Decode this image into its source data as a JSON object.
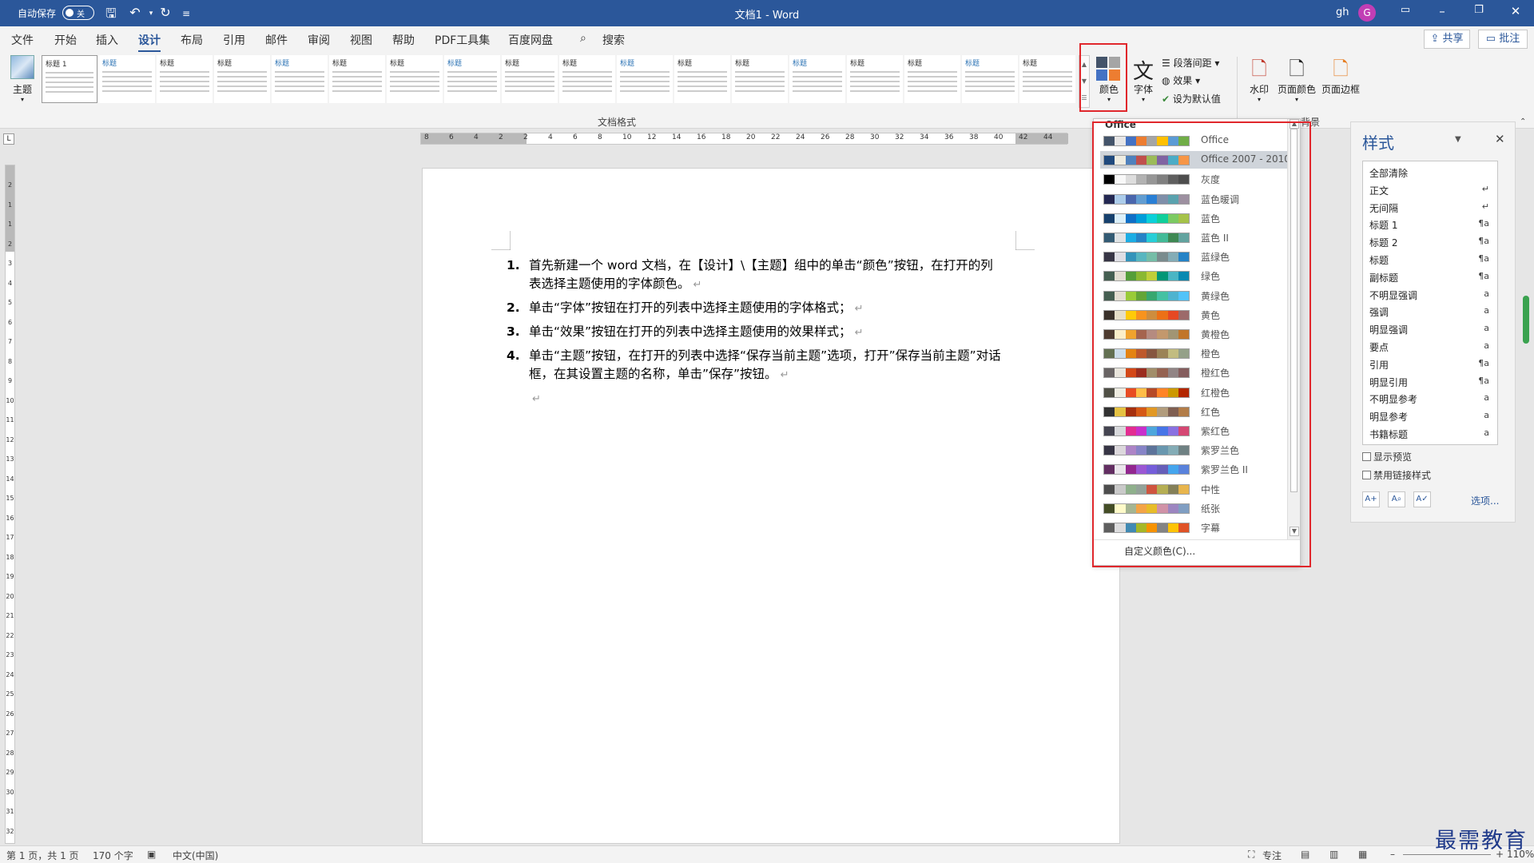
{
  "titlebar": {
    "autosave": "自动保存",
    "autosave_state": "关",
    "title": "文档1  -  Word",
    "user": "gh",
    "avatar_letter": "G"
  },
  "tabs": [
    "文件",
    "开始",
    "插入",
    "设计",
    "布局",
    "引用",
    "邮件",
    "审阅",
    "视图",
    "帮助",
    "PDF工具集",
    "百度网盘"
  ],
  "search_label": "搜索",
  "share_label": "共享",
  "comment_label": "批注",
  "ribbon": {
    "theme_label": "主题",
    "gallery_headings": [
      "标题 1",
      "标题",
      "标题",
      "标题",
      "标题",
      "标题",
      "标题",
      "标题",
      "标题",
      "标题",
      "标题",
      "标题",
      "标题",
      "标题",
      "标题",
      "标题",
      "标题",
      "标题"
    ],
    "group_label_format": "文档格式",
    "colors_label": "颜色",
    "fonts_label": "字体",
    "para_spacing_label": "段落间距",
    "effects_label": "效果",
    "set_default_label": "设为默认值",
    "watermark_label": "水印",
    "page_color_label": "页面颜色",
    "page_border_label": "页面边框",
    "group_label_background": "背景"
  },
  "ruler_numbers": [
    "8",
    "6",
    "4",
    "2",
    "2",
    "4",
    "6",
    "8",
    "10",
    "12",
    "14",
    "16",
    "18",
    "20",
    "22",
    "24",
    "26",
    "28",
    "30",
    "32",
    "34",
    "36",
    "38",
    "40",
    "42",
    "44"
  ],
  "vruler_numbers": [
    "2",
    "1",
    "1",
    "2",
    "3",
    "4",
    "5",
    "6",
    "7",
    "8",
    "9",
    "10",
    "11",
    "12",
    "13",
    "14",
    "15",
    "16",
    "17",
    "18",
    "19",
    "20",
    "21",
    "22",
    "23",
    "24",
    "25",
    "26",
    "27",
    "28",
    "29",
    "30",
    "31",
    "32"
  ],
  "document": {
    "items": [
      {
        "n": "1.",
        "text": "首先新建一个 word 文档，在【设计】\\【主题】组中的单击“颜色”按钮，在打开的列表选择主题使用的字体颜色。"
      },
      {
        "n": "2.",
        "text": "单击“字体”按钮在打开的列表中选择主题使用的字体格式；"
      },
      {
        "n": "3.",
        "text": "单击“效果”按钮在打开的列表中选择主题使用的效果样式；"
      },
      {
        "n": "4.",
        "text": "单击“主题”按钮，在打开的列表中选择“保存当前主题”选项，打开”保存当前主题”对话框，在其设置主题的名称，单击”保存”按钮。"
      }
    ],
    "para_mark": "↵"
  },
  "colors_dropdown": {
    "header": "Office",
    "selected_index": 1,
    "custom_label": "自定义颜色(C)...",
    "schemes": [
      {
        "name": "Office",
        "colors": [
          "#44546a",
          "#e7e6e6",
          "#4472c4",
          "#ed7d31",
          "#a5a5a5",
          "#ffc000",
          "#5b9bd5",
          "#70ad47"
        ]
      },
      {
        "name": "Office 2007 - 2010",
        "colors": [
          "#1f497d",
          "#eeece1",
          "#4f81bd",
          "#c0504d",
          "#9bbb59",
          "#8064a2",
          "#4bacc6",
          "#f79646"
        ]
      },
      {
        "name": "灰度",
        "colors": [
          "#000000",
          "#f8f8f8",
          "#dddddd",
          "#b2b2b2",
          "#969696",
          "#808080",
          "#5f5f5f",
          "#4d4d4d"
        ]
      },
      {
        "name": "蓝色暖调",
        "colors": [
          "#242852",
          "#acccea",
          "#4a66ac",
          "#629dd1",
          "#297fd5",
          "#7f8fa9",
          "#5aa2ae",
          "#9d90a0"
        ]
      },
      {
        "name": "蓝色",
        "colors": [
          "#17406d",
          "#dbeff9",
          "#0f6fc6",
          "#009dd9",
          "#0bd0d9",
          "#10cf9b",
          "#7cca62",
          "#a5c249"
        ]
      },
      {
        "name": "蓝色 II",
        "colors": [
          "#335b74",
          "#dfe3e5",
          "#1cade4",
          "#2683c6",
          "#27ced7",
          "#42ba97",
          "#3e8853",
          "#62a39f"
        ]
      },
      {
        "name": "蓝绿色",
        "colors": [
          "#373545",
          "#dedee4",
          "#3494ba",
          "#58b6c0",
          "#75bda7",
          "#7a8c8e",
          "#84acb6",
          "#2683c6"
        ]
      },
      {
        "name": "绿色",
        "colors": [
          "#455f51",
          "#e3ded1",
          "#549e39",
          "#8ab833",
          "#c0cf3a",
          "#029676",
          "#4ab5c4",
          "#0989b1"
        ]
      },
      {
        "name": "黄绿色",
        "colors": [
          "#455f51",
          "#e3ded1",
          "#99cb38",
          "#63a537",
          "#37a76f",
          "#44c1a3",
          "#4eb3cf",
          "#51c3f9"
        ]
      },
      {
        "name": "黄色",
        "colors": [
          "#39302a",
          "#e5dec9",
          "#ffca08",
          "#f8931d",
          "#ce8d3e",
          "#ec7016",
          "#e64823",
          "#9c6a6a"
        ]
      },
      {
        "name": "黄橙色",
        "colors": [
          "#4e3b30",
          "#fbeec9",
          "#f0a22e",
          "#a5644e",
          "#b58b80",
          "#c3986d",
          "#a19574",
          "#c17529"
        ]
      },
      {
        "name": "橙色",
        "colors": [
          "#637052",
          "#ccddea",
          "#e48312",
          "#bd582c",
          "#865640",
          "#9b8357",
          "#c2bc80",
          "#94a088"
        ]
      },
      {
        "name": "橙红色",
        "colors": [
          "#696464",
          "#e9e5dc",
          "#d34817",
          "#9b2d1f",
          "#a28e6a",
          "#956251",
          "#918485",
          "#855d5d"
        ]
      },
      {
        "name": "红橙色",
        "colors": [
          "#505046",
          "#eeece1",
          "#e84c22",
          "#ffbd47",
          "#b64926",
          "#ff8427",
          "#cc9900",
          "#b22600"
        ]
      },
      {
        "name": "红色",
        "colors": [
          "#323232",
          "#e5c243",
          "#a5300f",
          "#d55816",
          "#e19825",
          "#b19c7d",
          "#7f5f52",
          "#b27d49"
        ]
      },
      {
        "name": "紫红色",
        "colors": [
          "#454551",
          "#d8d9dc",
          "#e32d91",
          "#c830cc",
          "#4ea6dc",
          "#4775e7",
          "#8971e1",
          "#d54773"
        ]
      },
      {
        "name": "紫罗兰色",
        "colors": [
          "#373545",
          "#dcd8dc",
          "#ad84c6",
          "#8784c7",
          "#5d739a",
          "#6997af",
          "#84acb6",
          "#6f8183"
        ]
      },
      {
        "name": "紫罗兰色 II",
        "colors": [
          "#632e62",
          "#eae5eb",
          "#92278f",
          "#9b57d3",
          "#755dd9",
          "#665eb8",
          "#45a5ed",
          "#5982db"
        ]
      },
      {
        "name": "中性",
        "colors": [
          "#4d4d4d",
          "#c9c9c9",
          "#8fb08c",
          "#93a299",
          "#cf543f",
          "#b5ae53",
          "#848058",
          "#e8b54d"
        ]
      },
      {
        "name": "纸张",
        "colors": [
          "#444d26",
          "#fefac9",
          "#a5b592",
          "#f3a447",
          "#e7bc29",
          "#d092a7",
          "#9c85c0",
          "#809ec2"
        ]
      },
      {
        "name": "字幕",
        "colors": [
          "#5e5e5e",
          "#ddddde",
          "#418ab3",
          "#a6b727",
          "#f69200",
          "#838383",
          "#fec306",
          "#df5327"
        ]
      }
    ]
  },
  "styles_pane": {
    "title": "样式",
    "items": [
      {
        "name": "全部清除",
        "mark": ""
      },
      {
        "name": "正文",
        "mark": "↵"
      },
      {
        "name": "无间隔",
        "mark": "↵"
      },
      {
        "name": "标题 1",
        "mark": "¶a"
      },
      {
        "name": "标题 2",
        "mark": "¶a"
      },
      {
        "name": "标题",
        "mark": "¶a"
      },
      {
        "name": "副标题",
        "mark": "¶a"
      },
      {
        "name": "不明显强调",
        "mark": "a"
      },
      {
        "name": "强调",
        "mark": "a"
      },
      {
        "name": "明显强调",
        "mark": "a"
      },
      {
        "name": "要点",
        "mark": "a"
      },
      {
        "name": "引用",
        "mark": "¶a"
      },
      {
        "name": "明显引用",
        "mark": "¶a"
      },
      {
        "name": "不明显参考",
        "mark": "a"
      },
      {
        "name": "明显参考",
        "mark": "a"
      },
      {
        "name": "书籍标题",
        "mark": "a"
      }
    ],
    "show_preview": "显示预览",
    "disable_linked": "禁用链接样式",
    "options": "选项..."
  },
  "statusbar": {
    "page": "第 1 页，共 1 页",
    "words": "170 个字",
    "language": "中文(中国)",
    "focus": "专注",
    "zoom": "110%"
  },
  "watermark_text": "最需教育",
  "colors": {
    "accent": "#2b579a",
    "highlight": "#e0272c"
  }
}
